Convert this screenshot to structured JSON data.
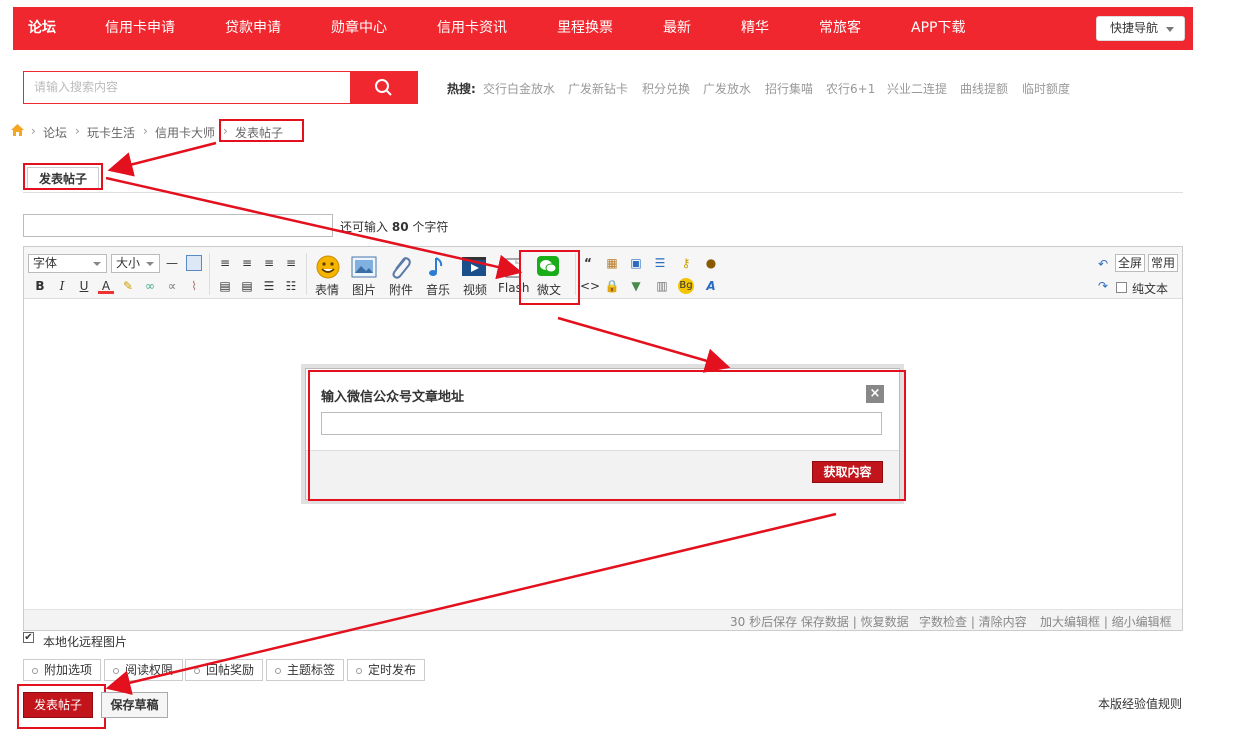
{
  "nav": {
    "items": [
      "论坛",
      "信用卡申请",
      "贷款申请",
      "勋章中心",
      "信用卡资讯",
      "里程换票",
      "最新",
      "精华",
      "常旅客",
      "APP下载"
    ],
    "quick_nav": "快捷导航"
  },
  "search": {
    "placeholder": "请输入搜索内容"
  },
  "hot": {
    "label": "热搜:",
    "items": [
      "交行白金放水",
      "广发新钻卡",
      "积分兑换",
      "广发放水",
      "招行集喵",
      "农行6+1",
      "兴业二连提",
      "曲线提额",
      "临时额度"
    ]
  },
  "breadcrumb": [
    "论坛",
    "玩卡生活",
    "信用卡大师",
    "发表帖子"
  ],
  "tab": {
    "label": "发表帖子"
  },
  "title_field": {
    "chars_left_prefix": "还可输入",
    "chars_left_count": "80",
    "chars_left_suffix": "个字符"
  },
  "toolbar": {
    "font": "字体",
    "size": "大小",
    "big_buttons": [
      "表情",
      "图片",
      "附件",
      "音乐",
      "视频",
      "Flash",
      "微文"
    ],
    "fullscreen": "全屏",
    "common": "常用",
    "plain_text": "纯文本"
  },
  "editor_footer": {
    "autosave": "30 秒后保存 保存数据 | 恢复数据",
    "check": "字数检查 | 清除内容",
    "resize": "加大编辑框 | 缩小编辑框"
  },
  "dialog": {
    "title": "输入微信公众号文章地址",
    "button": "获取内容",
    "close": "×"
  },
  "localize": {
    "checked": true,
    "label": "本地化远程图片"
  },
  "options": [
    "附加选项",
    "阅读权限",
    "回帖奖励",
    "主题标签",
    "定时发布"
  ],
  "actions": {
    "post": "发表帖子",
    "draft": "保存草稿",
    "rules": "本版经验值规则"
  },
  "colors": {
    "brand": "#f0272e",
    "button": "#c2141b",
    "annotation": "#e3101e"
  }
}
